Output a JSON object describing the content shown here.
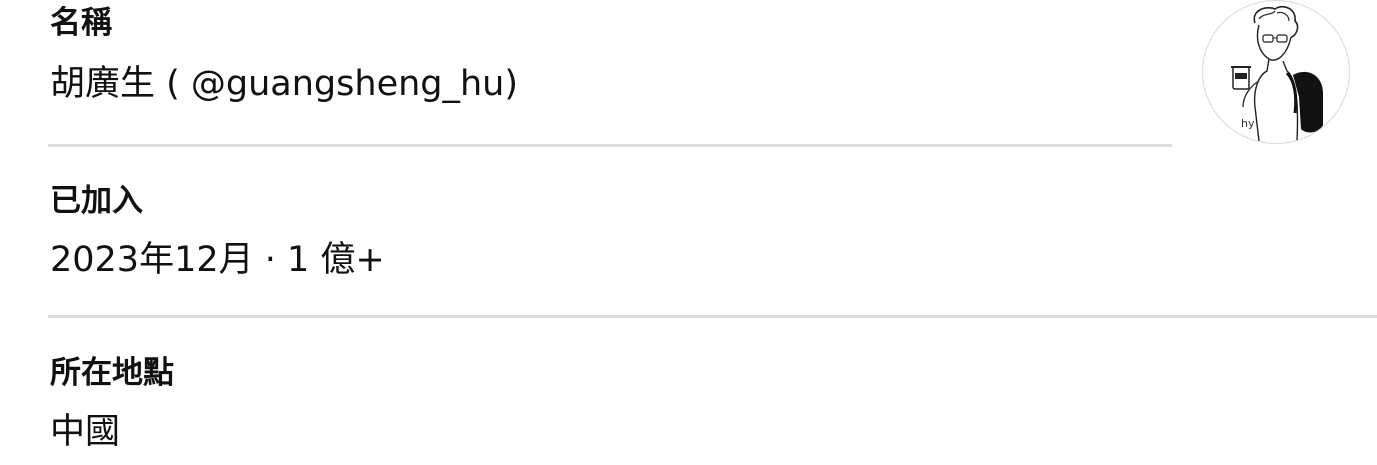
{
  "profile": {
    "name_label": "名稱",
    "name_value": "胡廣生 ( @guangsheng_hu)",
    "joined_label": "已加入",
    "joined_value": "2023年12月 · 1 億+",
    "location_label": "所在地點",
    "location_value": "中國"
  },
  "avatar": {
    "icon": "user-sketch-avatar",
    "signature": "hy"
  },
  "colors": {
    "text": "#111111",
    "divider": "#dddddd",
    "background": "#ffffff"
  }
}
